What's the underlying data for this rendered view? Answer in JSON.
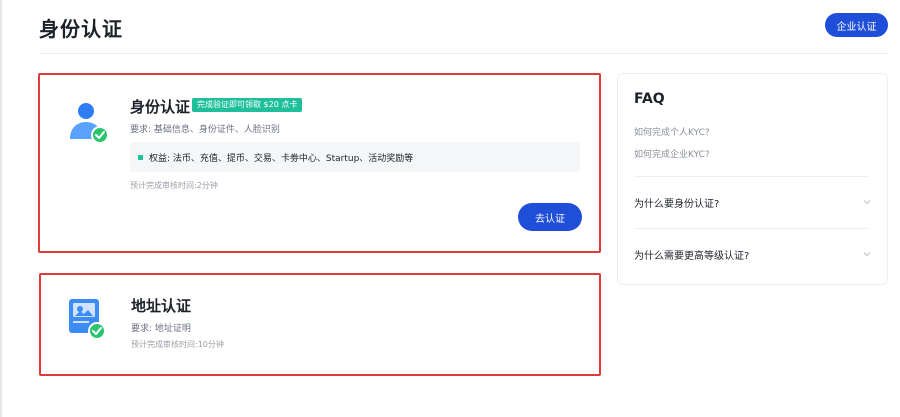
{
  "header": {
    "title": "身份认证",
    "enterprise_button": "企业认证"
  },
  "identity_card": {
    "title": "身份认证",
    "badge": "完成验证即可领取 $20 点卡",
    "requirements": "要求: 基础信息、身份证件、人脸识别",
    "benefits": "权益: 法币、充值、提币、交易、卡劵中心、Startup、活动奖励等",
    "review_time": "预计完成审核时间:2分钟",
    "button": "去认证"
  },
  "address_card": {
    "title": "地址认证",
    "requirements": "要求: 地址证明",
    "review_time": "预计完成审核时间:10分钟"
  },
  "faq": {
    "title": "FAQ",
    "links": [
      "如何完成个人KYC?",
      "如何完成企业KYC?"
    ],
    "questions": [
      "为什么要身份认证?",
      "为什么需要更高等级认证?"
    ]
  },
  "colors": {
    "primary": "#1f4fd8",
    "accent_green": "#1fbf9a",
    "highlight_border": "#e03a3a",
    "check_green": "#2cc56f"
  },
  "icons": {
    "identity": "user-verified-icon",
    "address": "address-document-icon",
    "faq_chevron": "chevron-down-icon"
  }
}
